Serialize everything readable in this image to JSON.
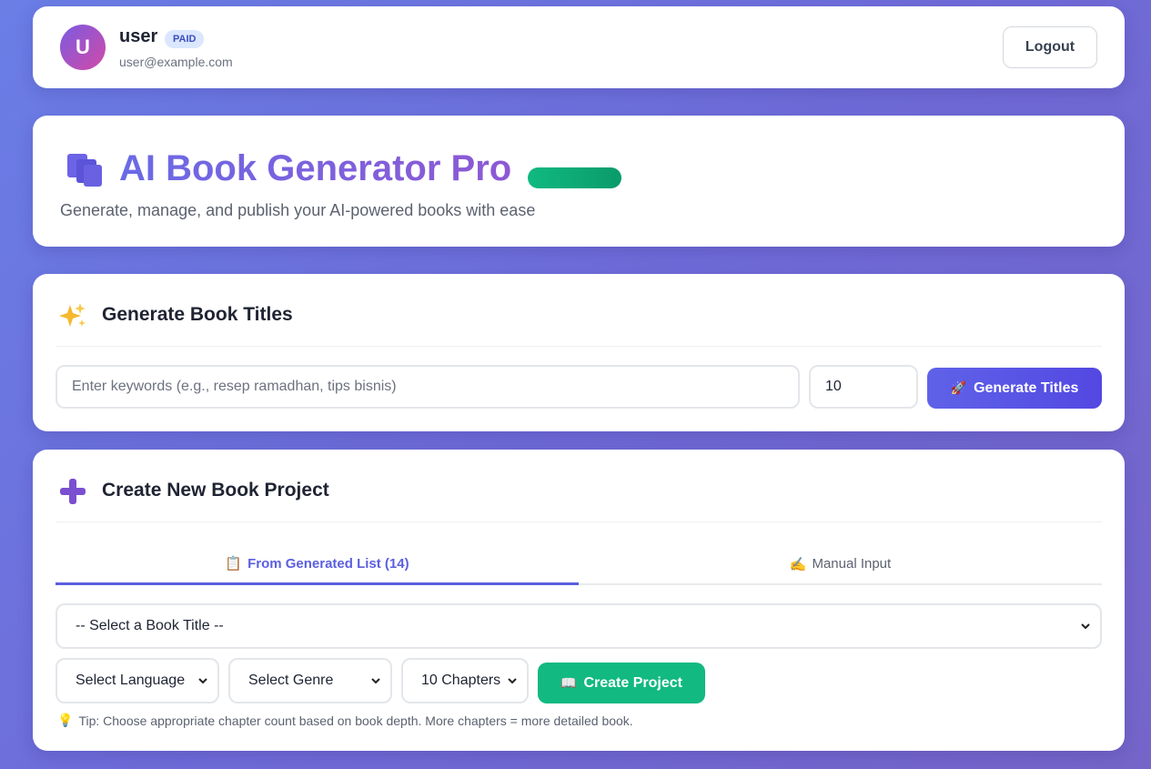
{
  "user": {
    "avatar_initial": "U",
    "name": "user",
    "badge": "PAID",
    "email": "user@example.com",
    "logout_label": "Logout"
  },
  "hero": {
    "title": "AI Book Generator Pro",
    "subtitle": "Generate, manage, and publish your AI-powered books with ease"
  },
  "generate_titles": {
    "icon": "sparkles-icon",
    "title": "Generate Book Titles",
    "keyword_placeholder": "Enter keywords (e.g., resep ramadhan, tips bisnis)",
    "keyword_value": "",
    "count_value": "10",
    "button_icon": "🚀",
    "button_label": "Generate Titles"
  },
  "create_project": {
    "icon": "plus-icon",
    "title": "Create New Book Project",
    "tabs": [
      {
        "icon": "📋",
        "label": "From Generated List (14)",
        "active": true
      },
      {
        "icon": "✍️",
        "label": "Manual Input",
        "active": false
      }
    ],
    "title_select": "-- Select a Book Title --",
    "language_select": "Select Language",
    "genre_select": "Select Genre",
    "chapter_select": "10 Chapters",
    "button_icon": "📖",
    "button_label": "Create Project",
    "tip_icon": "💡",
    "tip": "Tip: Choose appropriate chapter count based on book depth. More chapters = more detailed book."
  },
  "colors": {
    "background_start": "#6a7ee6",
    "background_end": "#7565c9",
    "primary": "#5b5fe0",
    "success": "#12b981",
    "badge_bg": "#dbe7ff"
  }
}
